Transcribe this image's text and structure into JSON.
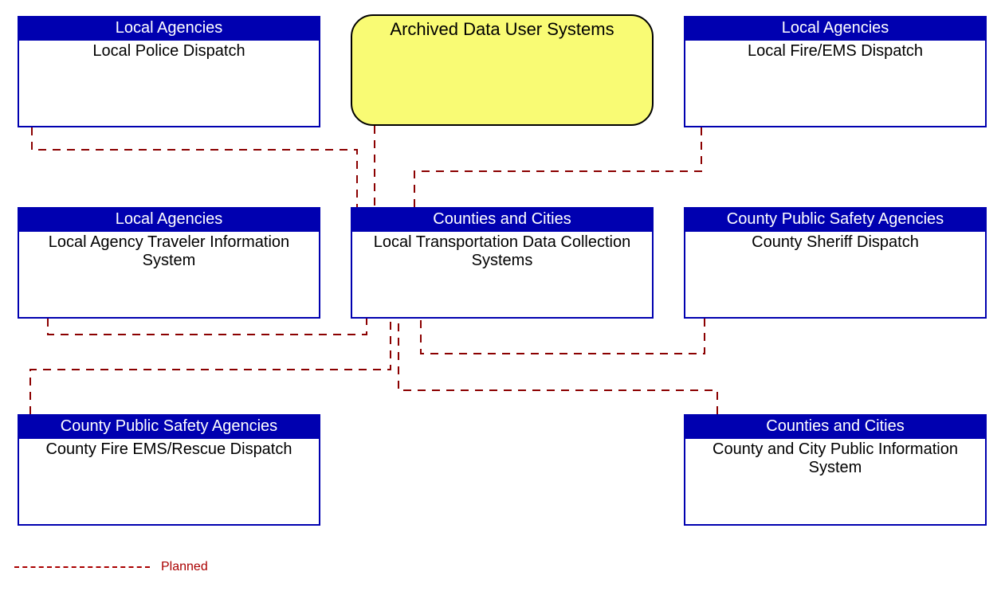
{
  "centerTop": {
    "title": "Archived Data User Systems"
  },
  "boxes": {
    "b1": {
      "header": "Local Agencies",
      "body": "Local Police Dispatch"
    },
    "b2": {
      "header": "Local Agencies",
      "body": "Local Fire/EMS Dispatch"
    },
    "b3": {
      "header": "Local Agencies",
      "body": "Local Agency Traveler Information System"
    },
    "b4": {
      "header": "Counties and Cities",
      "body": "Local Transportation Data Collection Systems"
    },
    "b5": {
      "header": "County Public Safety Agencies",
      "body": "County Sheriff Dispatch"
    },
    "b6": {
      "header": "County Public Safety Agencies",
      "body": "County Fire EMS/Rescue Dispatch"
    },
    "b7": {
      "header": "Counties and Cities",
      "body": "County and City Public Information System"
    }
  },
  "legend": {
    "label": "Planned"
  },
  "colors": {
    "headerBg": "#0000B0",
    "headerText": "#ffffff",
    "dashed": "#AA0000",
    "highlight": "#F9FB74"
  }
}
